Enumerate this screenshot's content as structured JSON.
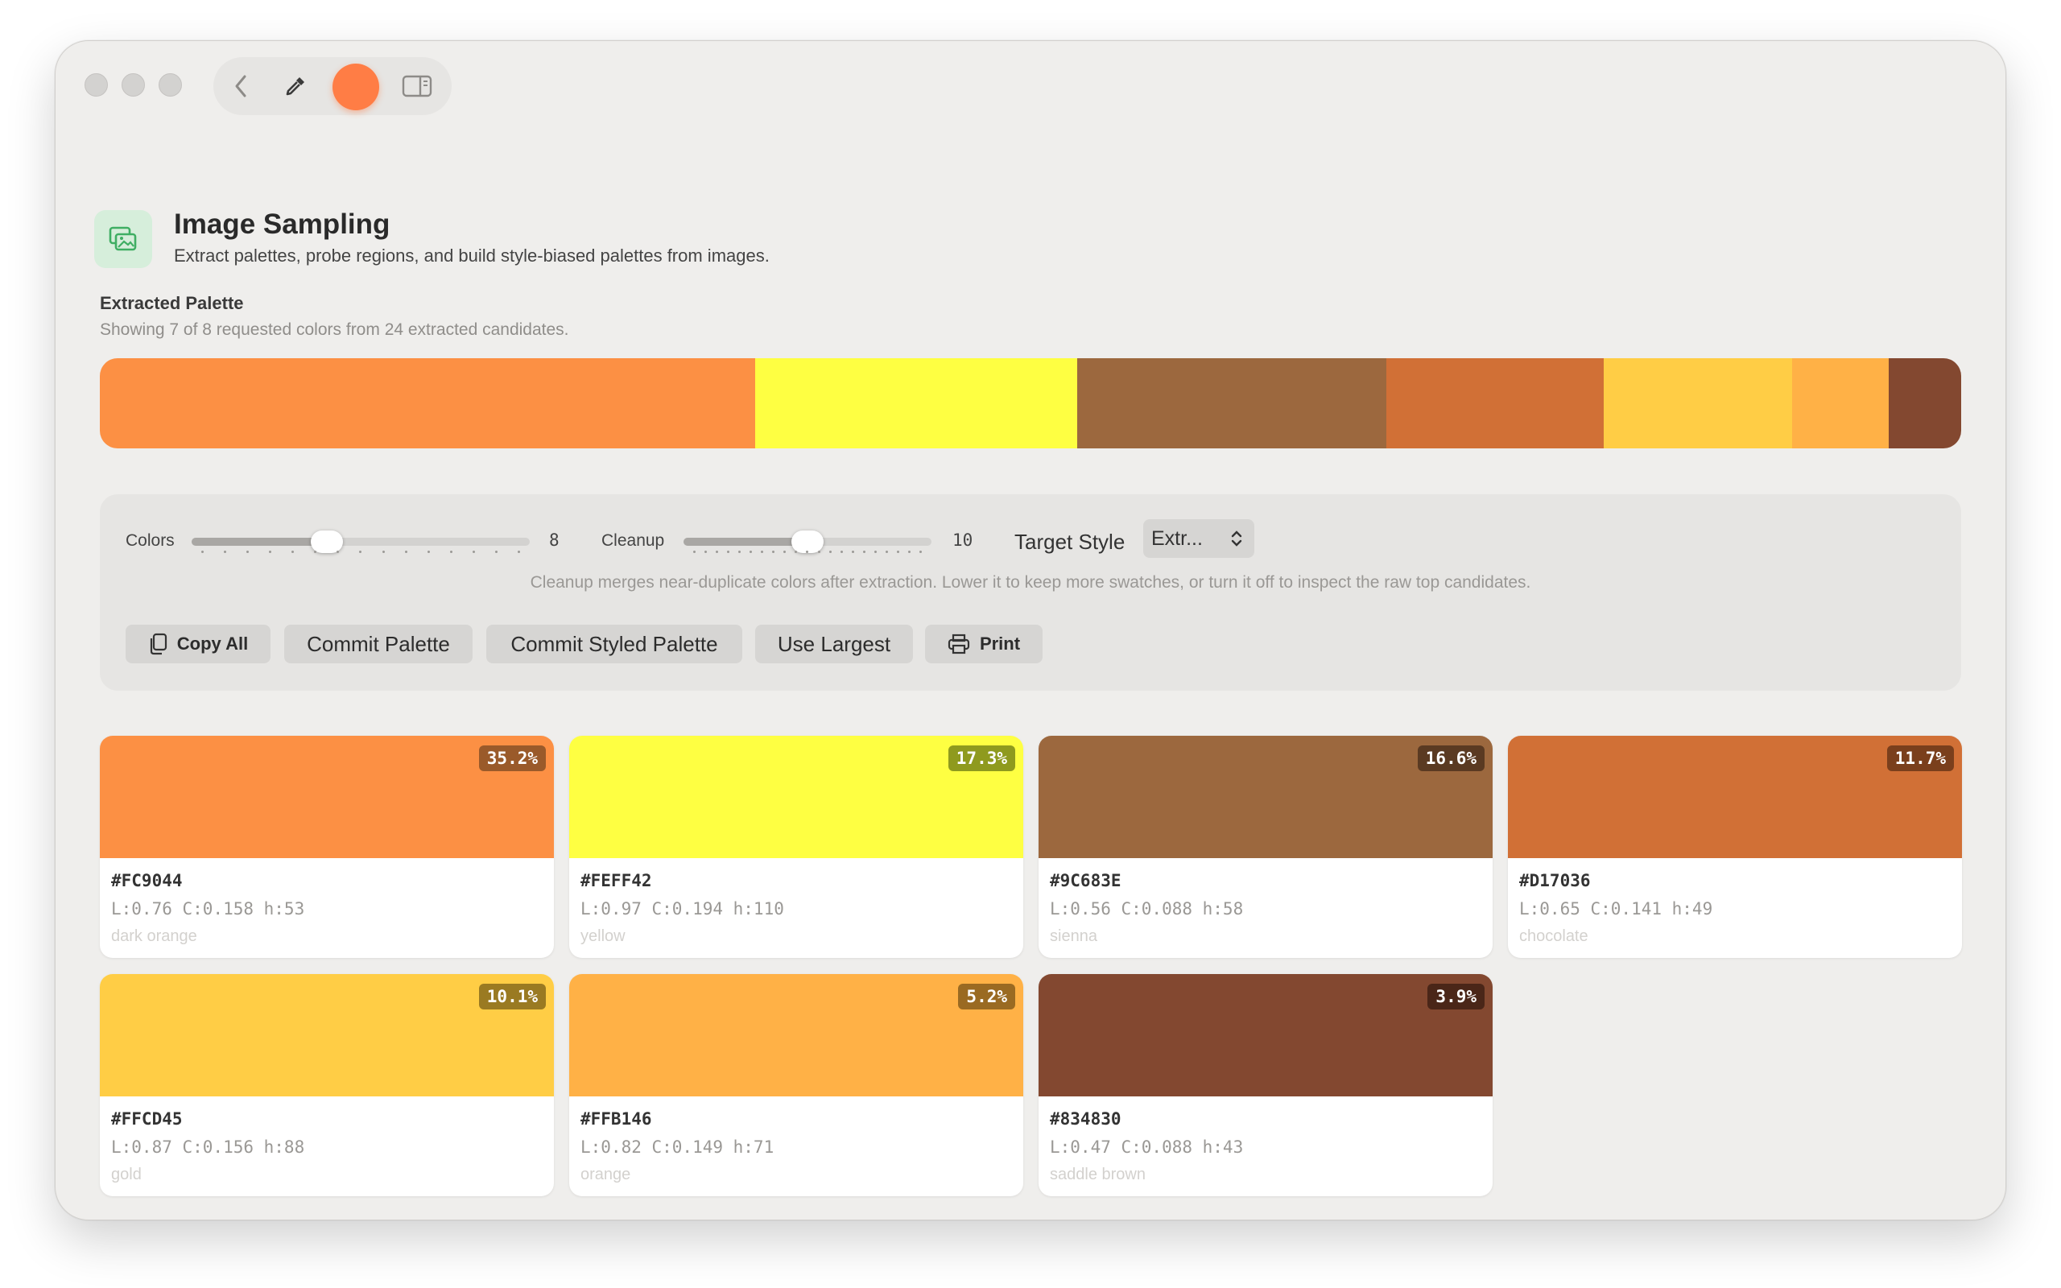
{
  "toolbar": {
    "back_icon": "chevron-left-icon",
    "picker_icon": "eyedropper-icon",
    "current_color": "#ff7d45",
    "sidebar_icon": "sidebar-toggle-icon"
  },
  "header": {
    "icon": "image-gallery-icon",
    "title": "Image Sampling",
    "subtitle": "Extract palettes, probe regions, and build style-biased palettes from images."
  },
  "palette": {
    "title": "Extracted Palette",
    "summary": "Showing 7 of 8 requested colors from 24 extracted candidates."
  },
  "controls": {
    "colors_label": "Colors",
    "colors_value": "8",
    "colors_slider_fraction": 0.4,
    "cleanup_label": "Cleanup",
    "cleanup_value": "10",
    "cleanup_slider_fraction": 0.5,
    "target_style_label": "Target Style",
    "target_style_value": "Extr...",
    "hint": "Cleanup merges near-duplicate colors after extraction. Lower it to keep more swatches, or turn it off to inspect the raw top candidates.",
    "buttons": {
      "copy_all": "Copy All",
      "commit_palette": "Commit Palette",
      "commit_styled_palette": "Commit Styled Palette",
      "use_largest": "Use Largest",
      "print": "Print"
    }
  },
  "swatches": [
    {
      "hex": "#FC9044",
      "color": "#fc9044",
      "percent": "35.2%",
      "share": 35.2,
      "lch": "L:0.76 C:0.158 h:53",
      "name": "dark orange",
      "badge": "#9a5a2a"
    },
    {
      "hex": "#FEFF42",
      "color": "#feff42",
      "percent": "17.3%",
      "share": 17.3,
      "lch": "L:0.97 C:0.194 h:110",
      "name": "yellow",
      "badge": "#8f9a1e"
    },
    {
      "hex": "#9C683E",
      "color": "#9c683e",
      "percent": "16.6%",
      "share": 16.6,
      "lch": "L:0.56 C:0.088 h:58",
      "name": "sienna",
      "badge": "#5a3a22"
    },
    {
      "hex": "#D17036",
      "color": "#d17036",
      "percent": "11.7%",
      "share": 11.7,
      "lch": "L:0.65 C:0.141 h:49",
      "name": "chocolate",
      "badge": "#7a3f1c"
    },
    {
      "hex": "#FFCD45",
      "color": "#ffcd45",
      "percent": "10.1%",
      "share": 10.1,
      "lch": "L:0.87 C:0.156 h:88",
      "name": "gold",
      "badge": "#9a7a22"
    },
    {
      "hex": "#FFB146",
      "color": "#ffb146",
      "percent": "5.2%",
      "share": 5.2,
      "lch": "L:0.82 C:0.149 h:71",
      "name": "orange",
      "badge": "#9a6a22"
    },
    {
      "hex": "#834830",
      "color": "#834830",
      "percent": "3.9%",
      "share": 3.9,
      "lch": "L:0.47 C:0.088 h:43",
      "name": "saddle brown",
      "badge": "#4a2618"
    }
  ]
}
